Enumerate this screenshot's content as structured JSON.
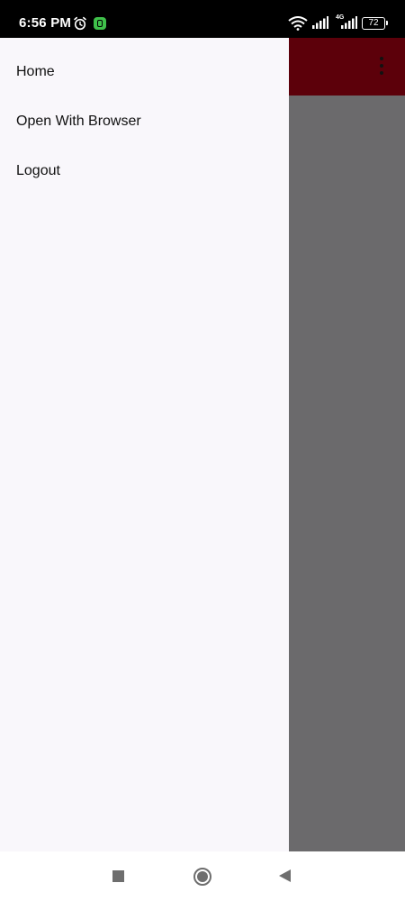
{
  "status_bar": {
    "time": "6:56 PM",
    "network_label": "4G",
    "battery": "72"
  },
  "drawer": {
    "items": [
      {
        "label": "Home"
      },
      {
        "label": "Open With Browser"
      },
      {
        "label": "Logout"
      }
    ]
  },
  "colors": {
    "app_bar": "#5c000a",
    "scrim": "#6b6a6c",
    "drawer_bg": "#f9f7fb"
  }
}
